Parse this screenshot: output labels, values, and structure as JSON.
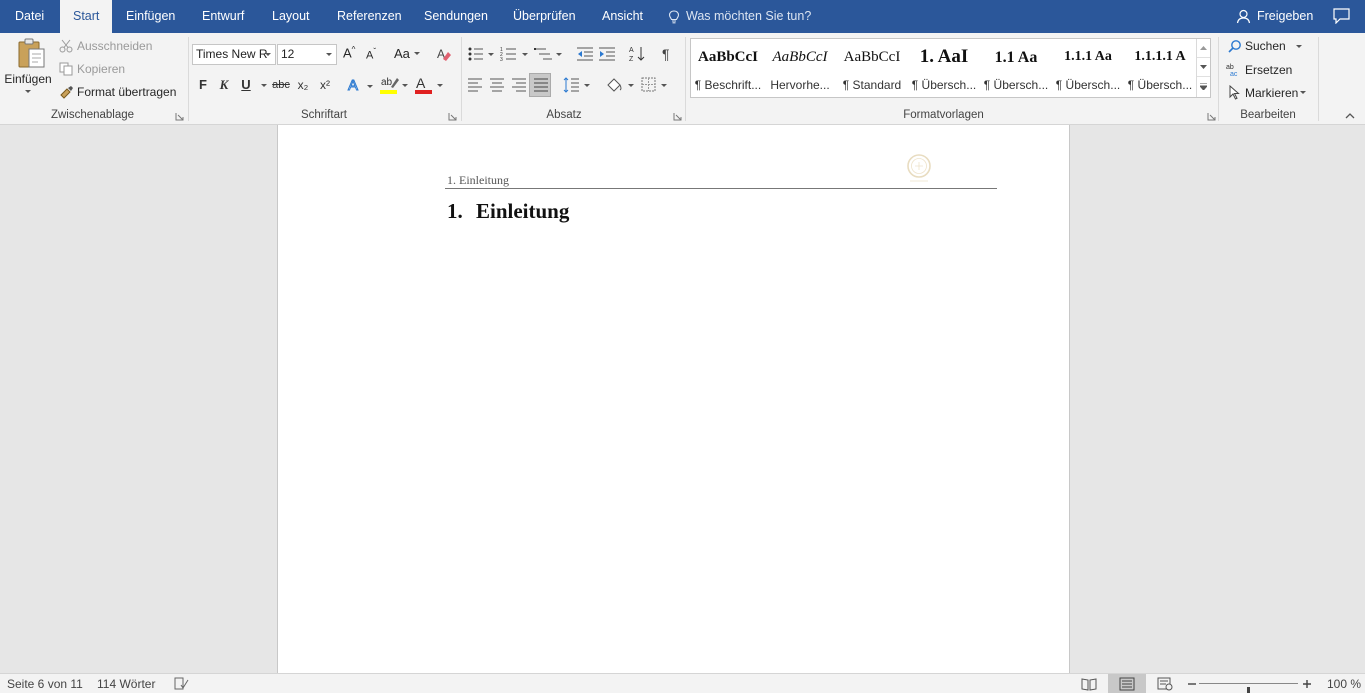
{
  "tabs": {
    "datei": "Datei",
    "start": "Start",
    "einfuegen": "Einfügen",
    "entwurf": "Entwurf",
    "layout": "Layout",
    "referenzen": "Referenzen",
    "sendungen": "Sendungen",
    "ueberpruefen": "Überprüfen",
    "ansicht": "Ansicht"
  },
  "tell_me": "Was möchten Sie tun?",
  "share": "Freigeben",
  "clipboard": {
    "paste": "Einfügen",
    "cut": "Ausschneiden",
    "copy": "Kopieren",
    "format_painter": "Format übertragen",
    "label": "Zwischenablage"
  },
  "font": {
    "name": "Times New R",
    "size": "12",
    "bold": "F",
    "italic": "K",
    "underline": "U",
    "strike": "abc",
    "subscript": "x₂",
    "superscript": "x²",
    "case_label": "Aa",
    "label": "Schriftart"
  },
  "paragraph": {
    "label": "Absatz"
  },
  "styles": {
    "label": "Formatvorlagen",
    "items": [
      {
        "sample": "AaBbCcI",
        "name": "¶ Beschrift..."
      },
      {
        "sample": "AaBbCcI",
        "name": "Hervorhe..."
      },
      {
        "sample": "AaBbCcI",
        "name": "¶ Standard"
      },
      {
        "sample": "1. AaI",
        "name": "¶ Übersch..."
      },
      {
        "sample": "1.1 Aa",
        "name": "¶ Übersch..."
      },
      {
        "sample": "1.1.1 Aa",
        "name": "¶ Übersch..."
      },
      {
        "sample": "1.1.1.1 A",
        "name": "¶ Übersch..."
      }
    ]
  },
  "editing": {
    "search": "Suchen",
    "replace": "Ersetzen",
    "select": "Markieren",
    "label": "Bearbeiten"
  },
  "document": {
    "header_text": "1. Einleitung",
    "heading_number": "1.",
    "heading_text": "Einleitung"
  },
  "status": {
    "page": "Seite 6 von 11",
    "words": "114 Wörter",
    "zoom": "100 %",
    "zoom_percent": 100
  },
  "colors": {
    "tab_bar": "#2b579a",
    "ribbon": "#f3f3f3",
    "highlight": "#ffff00",
    "font_color": "#e02020"
  }
}
